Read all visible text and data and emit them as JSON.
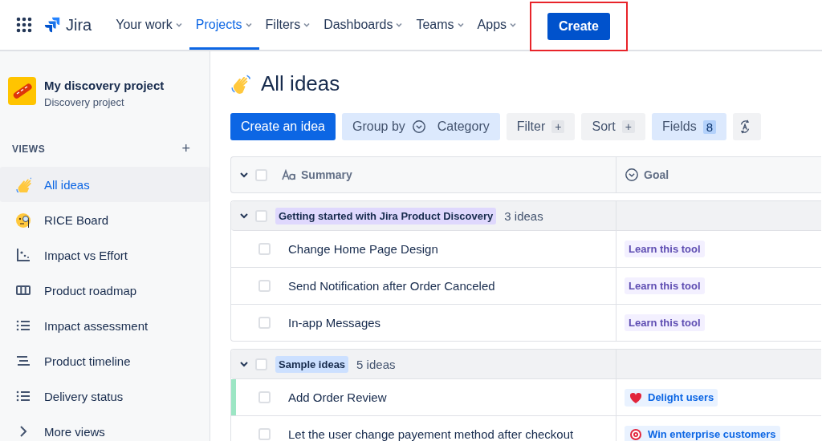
{
  "topbar": {
    "product": "Jira",
    "nav": [
      {
        "label": "Your work",
        "selected": false
      },
      {
        "label": "Projects",
        "selected": true
      },
      {
        "label": "Filters",
        "selected": false
      },
      {
        "label": "Dashboards",
        "selected": false
      },
      {
        "label": "Teams",
        "selected": false
      },
      {
        "label": "Apps",
        "selected": false
      }
    ],
    "create": {
      "label": "Create",
      "highlighted": true
    }
  },
  "sidebar": {
    "project": {
      "name": "My discovery project",
      "type": "Discovery project"
    },
    "views_heading": "VIEWS",
    "add": "+",
    "items": [
      {
        "label": "All ideas",
        "selected": true
      },
      {
        "label": "RICE Board",
        "selected": false
      },
      {
        "label": "Impact vs Effort",
        "selected": false
      },
      {
        "label": "Product roadmap",
        "selected": false
      },
      {
        "label": "Impact assessment",
        "selected": false
      },
      {
        "label": "Product timeline",
        "selected": false
      },
      {
        "label": "Delivery status",
        "selected": false
      },
      {
        "label": "More views",
        "selected": false
      }
    ]
  },
  "main": {
    "title": "All ideas",
    "toolbar": {
      "create": "Create an idea",
      "group_by": "Group by",
      "group_value": "Category",
      "filter": "Filter",
      "filter_add": "+",
      "sort": "Sort",
      "sort_add": "+",
      "fields": "Fields",
      "fields_count": "8"
    },
    "table": {
      "all_checked": false,
      "columns": [
        {
          "label": "Summary"
        },
        {
          "label": "Goal"
        }
      ],
      "groups": [
        {
          "label": "Getting started with Jira Product Discovery",
          "count": "3 ideas",
          "color": "#dfd8fd",
          "expanded": true,
          "checked": false,
          "rows": [
            {
              "summary": "Change Home Page Design",
              "checked": false,
              "accent": false,
              "goal": {
                "label": "Learn this tool",
                "kind": "plain",
                "color": "#5e4db2"
              }
            },
            {
              "summary": "Send Notification after Order Canceled",
              "checked": false,
              "accent": false,
              "goal": {
                "label": "Learn this tool",
                "kind": "plain",
                "color": "#5e4db2"
              }
            },
            {
              "summary": "In-app Messages",
              "checked": false,
              "accent": false,
              "goal": {
                "label": "Learn this tool",
                "kind": "plain",
                "color": "#5e4db2"
              }
            }
          ]
        },
        {
          "label": "Sample ideas",
          "count": "5 ideas",
          "color": "#cce0ff",
          "expanded": true,
          "checked": false,
          "rows": [
            {
              "summary": "Add Order Review",
              "checked": false,
              "accent": true,
              "goal": {
                "label": "Delight users",
                "kind": "heart",
                "color": "#0c66e4"
              }
            },
            {
              "summary": "Let the user change payement method after checkout",
              "checked": false,
              "accent": false,
              "goal": {
                "label": "Win enterprise customers",
                "kind": "target",
                "color": "#0c66e4"
              }
            }
          ]
        }
      ]
    }
  }
}
